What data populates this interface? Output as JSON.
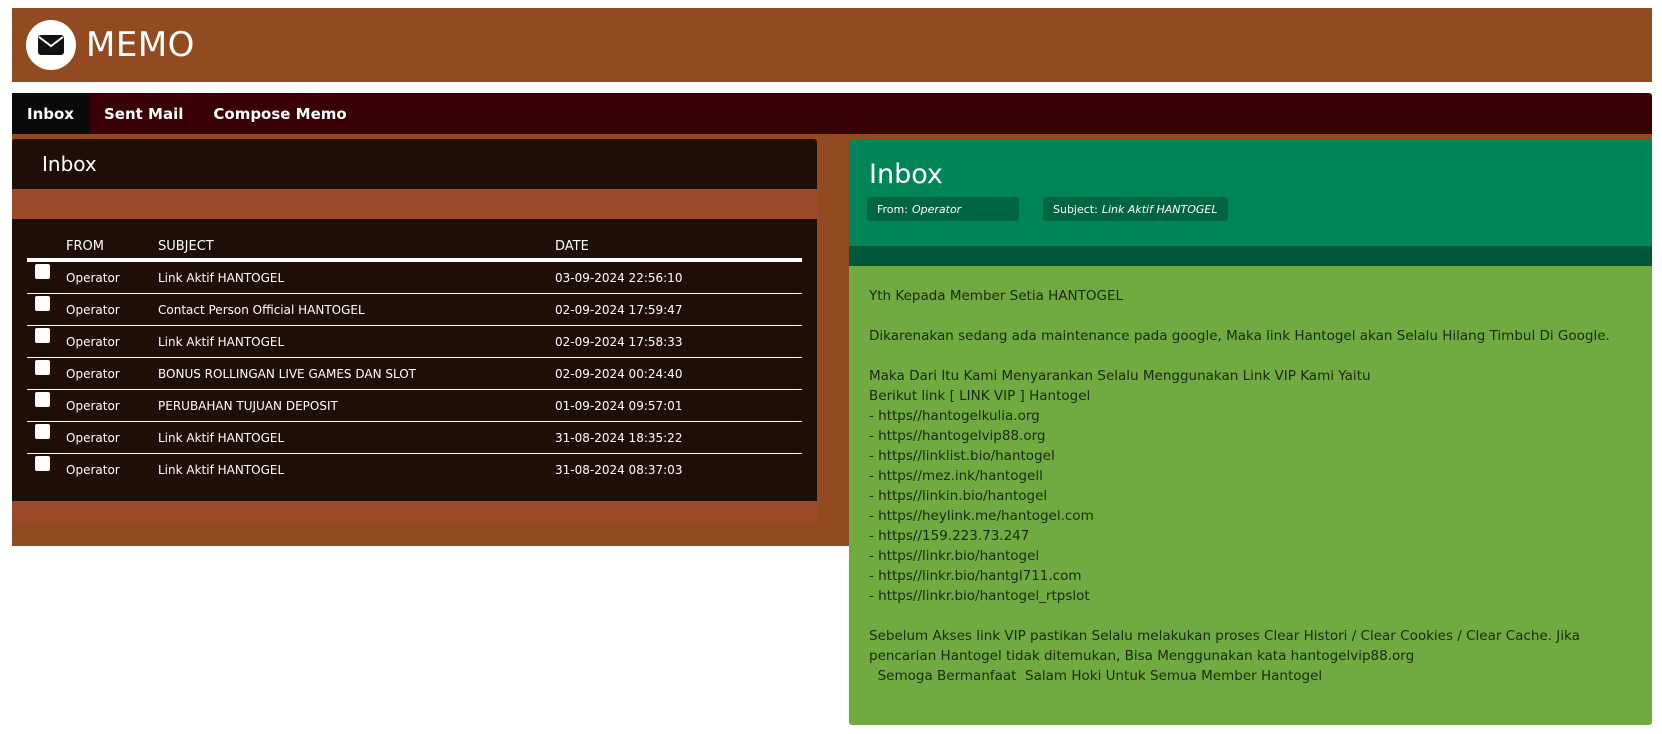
{
  "app": {
    "title": "MEMO",
    "logo_icon": "envelope-icon"
  },
  "nav": {
    "items": [
      {
        "label": "Inbox",
        "active": true
      },
      {
        "label": "Sent Mail",
        "active": false
      },
      {
        "label": "Compose Memo",
        "active": false
      }
    ]
  },
  "inbox_list": {
    "title": "Inbox",
    "columns": {
      "from": "FROM",
      "subject": "SUBJECT",
      "date": "DATE"
    },
    "rows": [
      {
        "from": "Operator",
        "subject": "Link Aktif HANTOGEL",
        "date": "03-09-2024 22:56:10"
      },
      {
        "from": "Operator",
        "subject": "Contact Person Official HANTOGEL",
        "date": "02-09-2024 17:59:47"
      },
      {
        "from": "Operator",
        "subject": "Link Aktif HANTOGEL",
        "date": "02-09-2024 17:58:33"
      },
      {
        "from": "Operator",
        "subject": "BONUS ROLLINGAN LIVE GAMES DAN SLOT",
        "date": "02-09-2024 00:24:40"
      },
      {
        "from": "Operator",
        "subject": "PERUBAHAN TUJUAN DEPOSIT",
        "date": "01-09-2024 09:57:01"
      },
      {
        "from": "Operator",
        "subject": "Link Aktif HANTOGEL",
        "date": "31-08-2024 18:35:22"
      },
      {
        "from": "Operator",
        "subject": "Link Aktif HANTOGEL",
        "date": "31-08-2024 08:37:03"
      }
    ]
  },
  "message": {
    "title": "Inbox",
    "from_label": "From:",
    "from_value": "Operator",
    "subject_label": "Subject:",
    "subject_value": "Link Aktif HANTOGEL",
    "greeting": "Yth Kepada Member Setia HANTOGEL",
    "paragraph1": "Dikarenakan sedang ada maintenance pada google, Maka link Hantogel akan Selalu Hilang Timbul Di Google.",
    "paragraph2_line1": "Maka Dari Itu Kami Menyarankan Selalu Menggunakan Link VIP Kami Yaitu",
    "paragraph2_line2": "Berikut link [ LINK VIP ] Hantogel",
    "links": [
      "- https//hantogelkulia.org",
      "- https//hantogelvip88.org",
      "- https//linklist.bio/hantogel",
      "- https//mez.ink/hantogell",
      "- https//linkin.bio/hantogel",
      "- https//heylink.me/hantogel.com",
      "- https//159.223.73.247",
      "- https//linkr.bio/hantogel",
      "- https//linkr.bio/hantgl711.com",
      "- https//linkr.bio/hantogel_rtpslot"
    ],
    "closing_line1": "Sebelum Akses link VIP pastikan Selalu melakukan proses Clear Histori / Clear Cookies / Clear Cache. Jika",
    "closing_line2": "pencarian Hantogel tidak ditemukan, Bisa Menggunakan kata hantogelvip88.org",
    "closing_line3": "  Semoga Bermanfaat  Salam Hoki Untuk Semua Member Hantogel"
  },
  "colors": {
    "header_brown": "#924a20",
    "nav_dark": "#380005",
    "table_dark": "#1e0e07",
    "msg_header_green": "#00845a",
    "msg_body_green": "#70aa41"
  }
}
